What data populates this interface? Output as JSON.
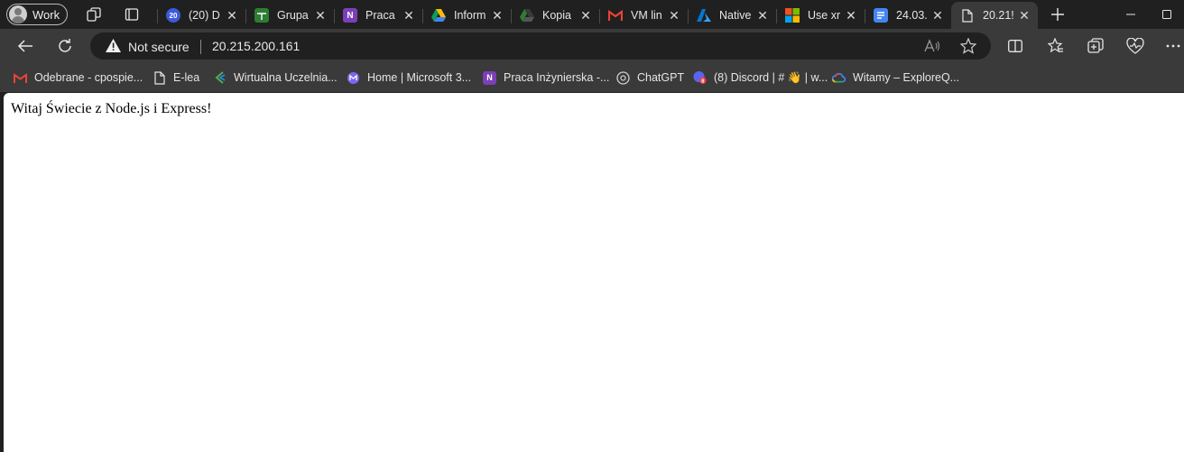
{
  "profile": {
    "label": "Work"
  },
  "tabs": [
    {
      "title": "(20) D",
      "icon": "lesson-planner-icon",
      "color": "#3b5bdb"
    },
    {
      "title": "Grupa",
      "icon": "sheets-grid-icon",
      "color": "#2e7d32"
    },
    {
      "title": "Praca",
      "icon": "onenote-icon",
      "color": "#7b3fb8"
    },
    {
      "title": "Inform",
      "icon": "google-drive-icon",
      "color": "#fbbc04"
    },
    {
      "title": "Kopia",
      "icon": "google-drive-dark-icon",
      "color": "#2e7d32"
    },
    {
      "title": "VM lin",
      "icon": "gmail-icon",
      "color": "#ea4335"
    },
    {
      "title": "Native",
      "icon": "azure-icon",
      "color": "#0078d4"
    },
    {
      "title": "Use xr",
      "icon": "microsoft-logo-icon",
      "color": "#f25022"
    },
    {
      "title": "24.03.",
      "icon": "google-docs-icon",
      "color": "#4285f4"
    },
    {
      "title": "20.21!",
      "icon": "blank-page-icon",
      "color": "#dddddd",
      "active": true
    }
  ],
  "toolbar": {
    "security_label": "Not secure",
    "url": "20.215.200.161"
  },
  "bookmarks": [
    {
      "label": "Odebrane - cpospie...",
      "icon": "gmail-icon",
      "color": "#ea4335"
    },
    {
      "label": "E-lea",
      "icon": "page-icon",
      "color": "#dddddd"
    },
    {
      "label": "Wirtualna Uczelnia...",
      "icon": "wirtualna-uczelnia-icon",
      "color": "#4caf50"
    },
    {
      "label": "Home | Microsoft 3...",
      "icon": "microsoft-365-icon",
      "color": "#7b68ee"
    },
    {
      "label": "Praca Inżynierska -...",
      "icon": "onenote-icon",
      "color": "#7b3fb8"
    },
    {
      "label": "ChatGPT",
      "icon": "chatgpt-icon",
      "color": "#cfcfcf"
    },
    {
      "label": "(8) Discord | # 👋 | w...",
      "icon": "discord-icon",
      "color": "#5865f2"
    },
    {
      "label": "Witamy – ExploreQ...",
      "icon": "google-cloud-icon",
      "color": "#4285f4"
    }
  ],
  "page": {
    "body_text": "Witaj Świecie z Node.js i Express!"
  }
}
